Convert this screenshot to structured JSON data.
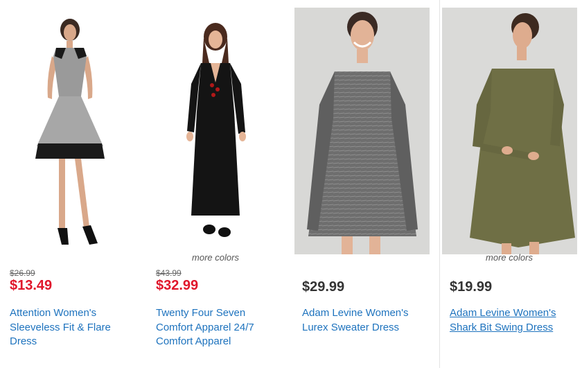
{
  "products": [
    {
      "image_icon": "dress-photo-sleeveless-fit-flare",
      "more_colors": "",
      "was_price": "$26.99",
      "price": "$13.49",
      "title": "Attention Women's Sleeveless Fit & Flare Dress"
    },
    {
      "image_icon": "dress-photo-maxi-black",
      "more_colors": "more colors",
      "was_price": "$43.99",
      "price": "$32.99",
      "title": "Twenty Four Seven Comfort Apparel 24/7 Comfort Apparel"
    },
    {
      "image_icon": "dress-photo-lurex-sweater",
      "more_colors": "",
      "was_price": "",
      "price": "$29.99",
      "title": "Adam Levine Women's Lurex Sweater Dress"
    },
    {
      "image_icon": "dress-photo-shark-bit-swing",
      "more_colors": "more colors",
      "was_price": "",
      "price": "$19.99",
      "title": "Adam Levine Women's Shark Bit Swing Dress"
    }
  ],
  "colors": {
    "sale_price": "#e0162b",
    "regular_price": "#333333",
    "link": "#1e73be"
  }
}
